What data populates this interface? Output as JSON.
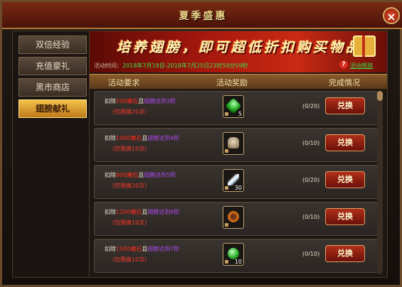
{
  "window": {
    "title": "夏季盛惠",
    "close_icon": "×"
  },
  "sidebar": {
    "items": [
      {
        "label": "双倍经验",
        "active": false
      },
      {
        "label": "充值豪礼",
        "active": false
      },
      {
        "label": "黑市商店",
        "active": false
      },
      {
        "label": "翅膀献礼",
        "active": true
      }
    ]
  },
  "banner": {
    "slogan": "培养翅膀，即可超低折扣购买物品",
    "time_label": "活动时间：",
    "time_value": "2018年7月19日-2018年7月25日23时59分59秒",
    "help_icon": "?",
    "rules_link": "活动规则"
  },
  "table": {
    "headers": {
      "requirement": "活动要求",
      "reward": "活动奖励",
      "status": "完成情况"
    },
    "rows": [
      {
        "req_prefix": "扣除",
        "req_amount": "500魔石",
        "req_mid": "且",
        "req_condition": "翅膀达到3阶",
        "req_limit": "（仅限换20次）",
        "item_icon": "gem-green-icon",
        "item_qty": "5",
        "progress": "(0/20)",
        "button": "兑换"
      },
      {
        "req_prefix": "扣除",
        "req_amount": "1000魔石",
        "req_mid": "且",
        "req_condition": "翅膀达到4阶",
        "req_limit": "（仅限换10次）",
        "item_icon": "bag-icon",
        "item_qty": "",
        "progress": "(0/10)",
        "button": "兑换"
      },
      {
        "req_prefix": "扣除",
        "req_amount": "800魔石",
        "req_mid": "且",
        "req_condition": "翅膀达到5阶",
        "req_limit": "（仅限换20次）",
        "item_icon": "feather-icon",
        "item_qty": "30",
        "progress": "(0/20)",
        "button": "兑换"
      },
      {
        "req_prefix": "扣除",
        "req_amount": "1200魔石",
        "req_mid": "且",
        "req_condition": "翅膀达到6阶",
        "req_limit": "（仅限换10次）",
        "item_icon": "ring-icon",
        "item_qty": "",
        "progress": "(0/10)",
        "button": "兑换"
      },
      {
        "req_prefix": "扣除",
        "req_amount": "1500魔石",
        "req_mid": "且",
        "req_condition": "翅膀达到7阶",
        "req_limit": "（仅限换10次）",
        "item_icon": "orb-icon",
        "item_qty": "10",
        "progress": "(0/10)",
        "button": "兑换"
      }
    ]
  },
  "colors": {
    "accent": "#f3c24a",
    "button": "#b0301a",
    "highlight_red": "#ff2a1a",
    "highlight_purple": "#b04af0",
    "time_green": "#3ae04a"
  }
}
